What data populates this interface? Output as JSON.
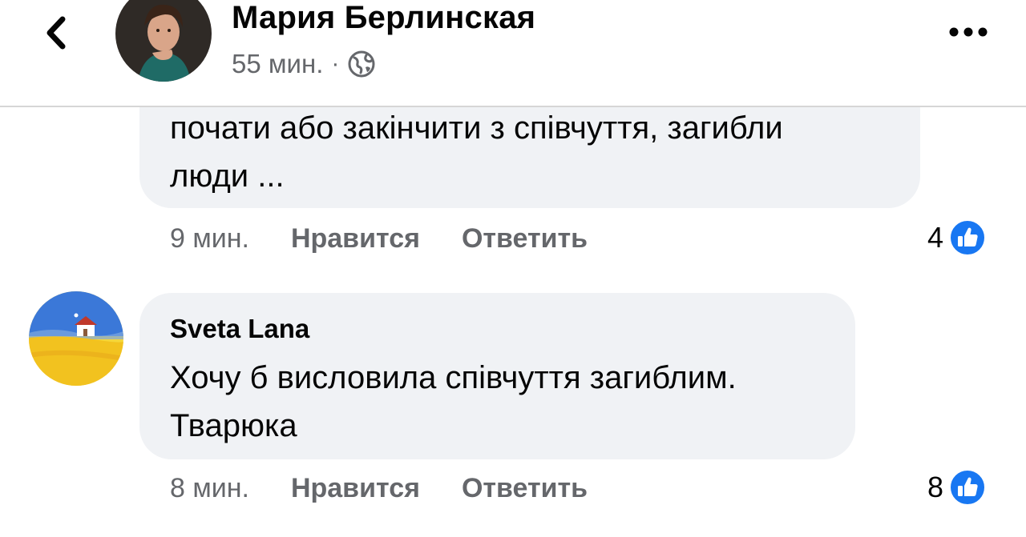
{
  "post_header": {
    "author_name": "Мария Берлинская",
    "time": "55 мин.",
    "separator": "·",
    "audience_icon": "globe-icon",
    "back_icon": "chevron-left-icon",
    "more_icon": "more-horizontal-icon"
  },
  "comments": [
    {
      "author_name": "",
      "text_lines": [
        "почати або закінчити з співчуття, загибли",
        "люди ..."
      ],
      "time": "9 мин.",
      "like_label": "Нравится",
      "reply_label": "Ответить",
      "reaction_count": "4",
      "reaction_icon": "like-icon"
    },
    {
      "author_name": "Sveta Lana",
      "text_lines": [
        "Хочу б висловила співчуття загиблим.",
        "Тварюка"
      ],
      "time": "8 мин.",
      "like_label": "Нравится",
      "reply_label": "Ответить",
      "reaction_count": "8",
      "reaction_icon": "like-icon"
    }
  ],
  "colors": {
    "bubble_bg": "#f0f2f5",
    "secondary_text": "#65676b",
    "like_blue": "#1877f2"
  }
}
